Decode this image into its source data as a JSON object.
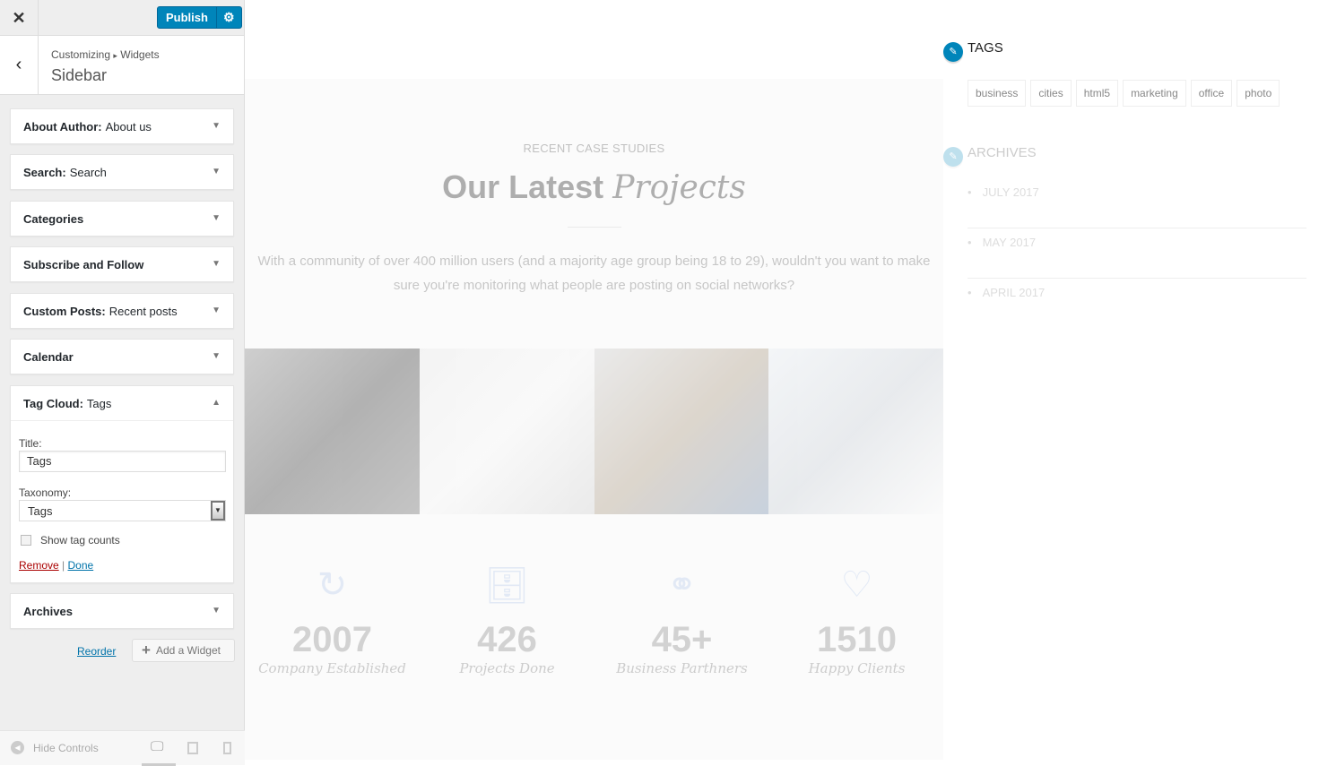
{
  "header": {
    "close_icon": "close-icon",
    "publish_label": "Publish",
    "settings_icon": "gear-icon"
  },
  "breadcrumb": {
    "root": "Customizing",
    "separator": "▸",
    "section": "Widgets",
    "title": "Sidebar"
  },
  "widgets": [
    {
      "type": "About Author:",
      "name": "About us",
      "expanded": false
    },
    {
      "type": "Search:",
      "name": "Search",
      "expanded": false
    },
    {
      "type": "Categories",
      "name": "",
      "expanded": false
    },
    {
      "type": "Subscribe and Follow",
      "name": "",
      "expanded": false
    },
    {
      "type": "Custom Posts:",
      "name": "Recent posts",
      "expanded": false
    },
    {
      "type": "Calendar",
      "name": "",
      "expanded": false
    },
    {
      "type": "Tag Cloud:",
      "name": "Tags",
      "expanded": true
    },
    {
      "type": "Archives",
      "name": "",
      "expanded": false
    }
  ],
  "tag_cloud_form": {
    "title_label": "Title:",
    "title_value": "Tags",
    "taxonomy_label": "Taxonomy:",
    "taxonomy_value": "Tags",
    "show_counts_label": "Show tag counts",
    "show_counts_checked": false,
    "remove_label": "Remove",
    "separator": "|",
    "done_label": "Done"
  },
  "actions": {
    "reorder": "Reorder",
    "add_widget": "Add a Widget"
  },
  "footer": {
    "hide_controls": "Hide Controls",
    "devices": [
      "desktop",
      "tablet",
      "mobile"
    ],
    "active_device": "desktop"
  },
  "preview": {
    "kicker": "RECENT CASE STUDIES",
    "heading_plain": "Our Latest",
    "heading_italic": "Projects",
    "description": "With a community of over 400 million users (and a majority age group being 18 to 29), wouldn't you want to make sure you're monitoring what people are posting on social networks?",
    "stats": [
      {
        "icon": "refresh-arrow-icon",
        "number": "2007",
        "caption": "Company Established"
      },
      {
        "icon": "file-cabinet-icon",
        "number": "426",
        "caption": "Projects Done"
      },
      {
        "icon": "partners-icon",
        "number": "45+",
        "caption": "Business Parthners"
      },
      {
        "icon": "happy-client-icon",
        "number": "1510",
        "caption": "Happy Clients"
      }
    ],
    "sidebar": {
      "tags_title": "TAGS",
      "tags": [
        "business",
        "cities",
        "html5",
        "marketing",
        "office",
        "photo"
      ],
      "archives_title": "ARCHIVES",
      "archives": [
        "JULY 2017",
        "MAY 2017",
        "APRIL 2017"
      ]
    }
  },
  "colors": {
    "accent": "#0085ba",
    "remove": "#a00",
    "link": "#0073aa"
  }
}
